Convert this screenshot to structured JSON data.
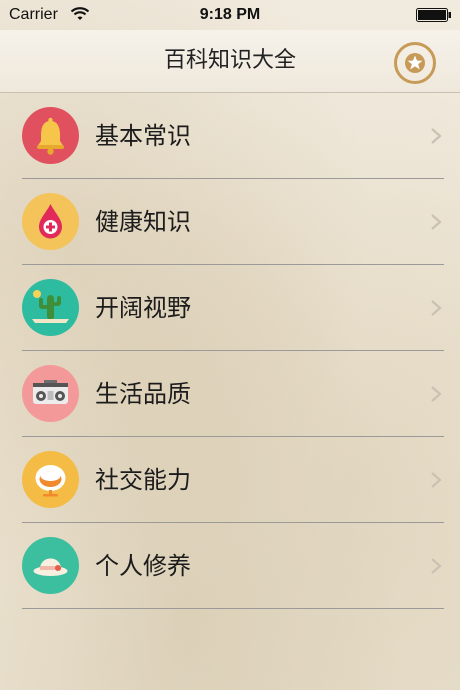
{
  "status_bar": {
    "carrier": "Carrier",
    "time": "9:18 PM"
  },
  "nav": {
    "title": "百科知识大全",
    "favorite_icon": "star-icon"
  },
  "colors": {
    "nav_accent": "#c79b57",
    "icon_bg": [
      "#e0505e",
      "#f4c35a",
      "#2ebca0",
      "#f4999a",
      "#f4bc44",
      "#3bbf9f"
    ]
  },
  "categories": [
    {
      "label": "基本常识",
      "icon": "bell-icon"
    },
    {
      "label": "健康知识",
      "icon": "blood-drop-icon"
    },
    {
      "label": "开阔视野",
      "icon": "cactus-icon"
    },
    {
      "label": "生活品质",
      "icon": "radio-icon"
    },
    {
      "label": "社交能力",
      "icon": "chair-icon"
    },
    {
      "label": "个人修养",
      "icon": "hat-icon"
    }
  ]
}
